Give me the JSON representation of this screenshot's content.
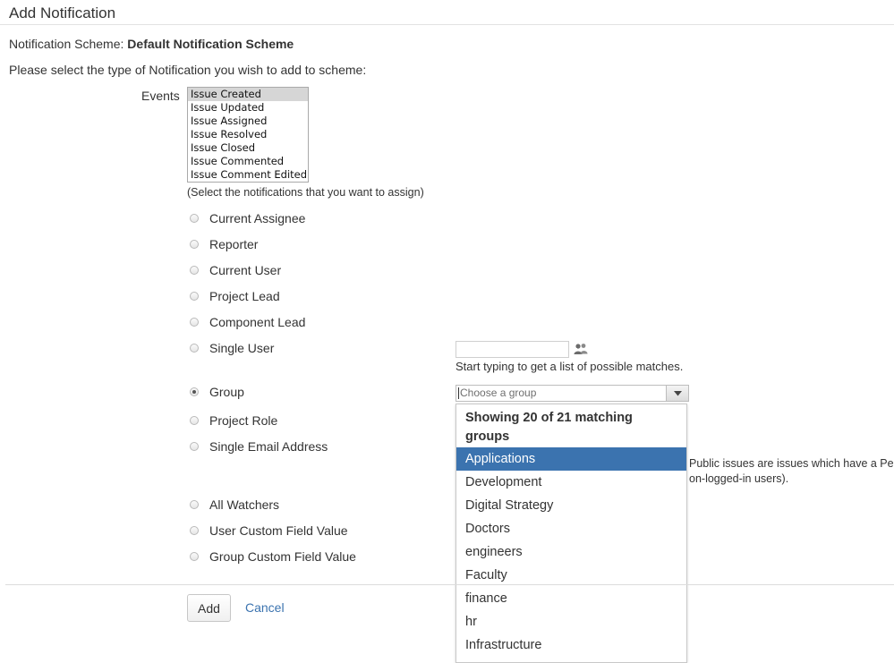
{
  "page": {
    "title": "Add Notification",
    "scheme_label": "Notification Scheme:",
    "scheme_name": "Default Notification Scheme",
    "prompt": "Please select the type of Notification you wish to add to scheme:"
  },
  "events": {
    "label": "Events",
    "options": [
      "Issue Created",
      "Issue Updated",
      "Issue Assigned",
      "Issue Resolved",
      "Issue Closed",
      "Issue Commented",
      "Issue Comment Edited"
    ],
    "selected": "Issue Created",
    "help": "(Select the notifications that you want to assign)"
  },
  "recipients": [
    {
      "label": "Current Assignee",
      "checked": false
    },
    {
      "label": "Reporter",
      "checked": false
    },
    {
      "label": "Current User",
      "checked": false
    },
    {
      "label": "Project Lead",
      "checked": false
    },
    {
      "label": "Component Lead",
      "checked": false
    },
    {
      "label": "Single User",
      "checked": false
    },
    {
      "label": "Group",
      "checked": true
    },
    {
      "label": "Project Role",
      "checked": false
    },
    {
      "label": "Single Email Address",
      "checked": false
    },
    {
      "label": "All Watchers",
      "checked": false
    },
    {
      "label": "User Custom Field Value",
      "checked": false
    },
    {
      "label": "Group Custom Field Value",
      "checked": false
    }
  ],
  "single_user": {
    "value": "",
    "hint": "Start typing to get a list of possible matches.",
    "icon": "user-picker-icon"
  },
  "group_picker": {
    "placeholder": "Choose a group",
    "header": "Showing 20 of 21 matching groups",
    "options": [
      "Applications",
      "Development",
      "Digital Strategy",
      "Doctors",
      "engineers",
      "Faculty",
      "finance",
      "hr",
      "Infrastructure"
    ],
    "active": "Applications"
  },
  "email_note": {
    "line1": "Public issues are issues which have a Pe",
    "line2": "on-logged-in users)."
  },
  "actions": {
    "add": "Add",
    "cancel": "Cancel"
  },
  "colors": {
    "accent": "#3b73af",
    "text": "#333333",
    "highlight_selected_event": "#d6d6d6"
  }
}
